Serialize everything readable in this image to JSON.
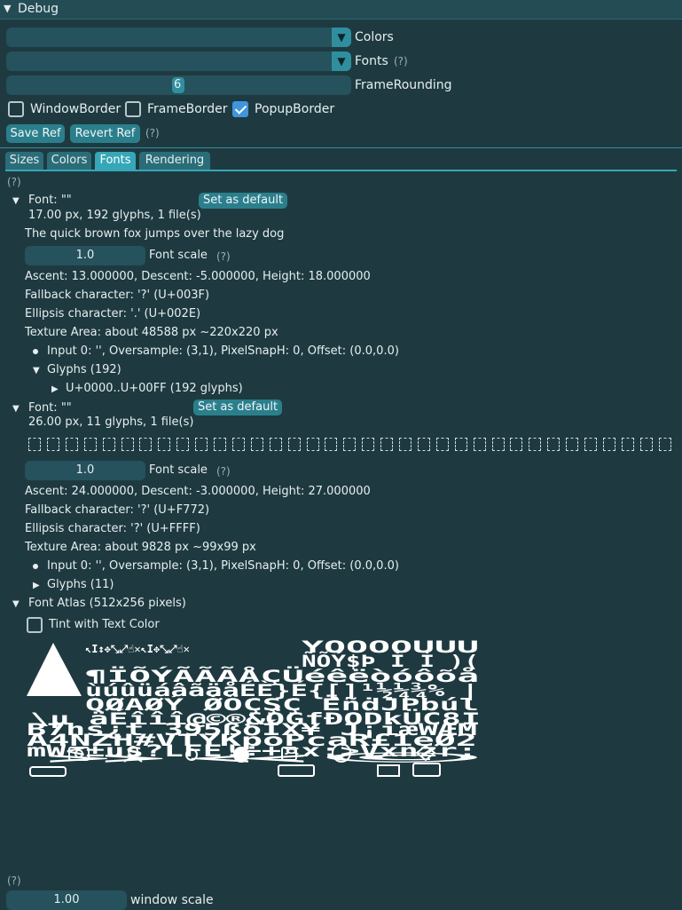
{
  "window": {
    "title": "Debug"
  },
  "controls": {
    "colors_label": "Colors",
    "fonts_label": "Fonts",
    "fonts_help": "(?)",
    "frame_rounding_value": "6",
    "frame_rounding_label": "FrameRounding",
    "window_border_label": "WindowBorder",
    "window_border_checked": false,
    "frame_border_label": "FrameBorder",
    "frame_border_checked": false,
    "popup_border_label": "PopupBorder",
    "popup_border_checked": true,
    "save_ref": "Save Ref",
    "revert_ref": "Revert Ref",
    "ref_help": "(?)"
  },
  "tabs": [
    {
      "label": "Sizes",
      "active": false
    },
    {
      "label": "Colors",
      "active": false
    },
    {
      "label": "Fonts",
      "active": true
    },
    {
      "label": "Rendering",
      "active": false
    }
  ],
  "fonts_help": "(?)",
  "font1": {
    "header": "Font: \"\"",
    "set_default": "Set as default",
    "summary": "17.00 px, 192 glyphs, 1 file(s)",
    "sample": "The quick brown fox jumps over the lazy dog",
    "scale_value": "1.0",
    "scale_label": "Font scale",
    "scale_help": "(?)",
    "metrics": "Ascent: 13.000000, Descent: -5.000000, Height: 18.000000",
    "fallback": "Fallback character: '?' (U+003F)",
    "ellipsis": "Ellipsis character: '.' (U+002E)",
    "texture": "Texture Area: about 48588 px ~220x220 px",
    "input": "Input 0: '', Oversample: (3,1), PixelSnapH: 0, Offset: (0.0,0.0)",
    "glyphs": "Glyphs (192)",
    "range": "U+0000..U+00FF (192 glyphs)"
  },
  "font2": {
    "header": "Font: \"\"",
    "set_default": "Set as default",
    "summary": "26.00 px, 11 glyphs, 1 file(s)",
    "scale_value": "1.0",
    "scale_label": "Font scale",
    "scale_help": "(?)",
    "metrics": "Ascent: 24.000000, Descent: -3.000000, Height: 27.000000",
    "fallback": "Fallback character: '?' (U+F772)",
    "ellipsis": "Ellipsis character: '?' (U+FFFF)",
    "texture": "Texture Area: about 9828 px ~99x99 px",
    "input": "Input 0: '', Oversample: (3,1), PixelSnapH: 0, Offset: (0.0,0.0)",
    "glyphs": "Glyphs (11)"
  },
  "atlas": {
    "header": "Font Atlas (512x256 pixels)",
    "tint_label": "Tint with Text Color",
    "tint_checked": false,
    "rows": [
      "ŸÕÕÕÕÙÚÛ",
      "ÑÕÝ$Þ Ì Ì )(",
      "¶ÏÕÝÃÃÃÅÇÜéêëòóôõå",
      "ùúûüáâãäåÉÈ}É{[]¹½¼¾% |",
      "QØAØÝ ǾÖÇŞÇ ËñḋJPbúl",
      "\\µ äÉîîî@©®&ÖGfÐODkÜC8I",
      "B7hs¿t 395ßδÍX¥ J¡iæWÆM",
      "A4NZH#VTYKpoPcaR£1eØ2",
      "mW<±us?LFE!÷+¤x:>Vxnzr;",
      "»«©"
    ]
  },
  "bottom": {
    "help": "(?)",
    "scale_value": "1.00",
    "scale_label": "window scale"
  },
  "icons": {
    "collapse": "triangle-down",
    "expand": "triangle-right",
    "combo": "triangle-down"
  }
}
